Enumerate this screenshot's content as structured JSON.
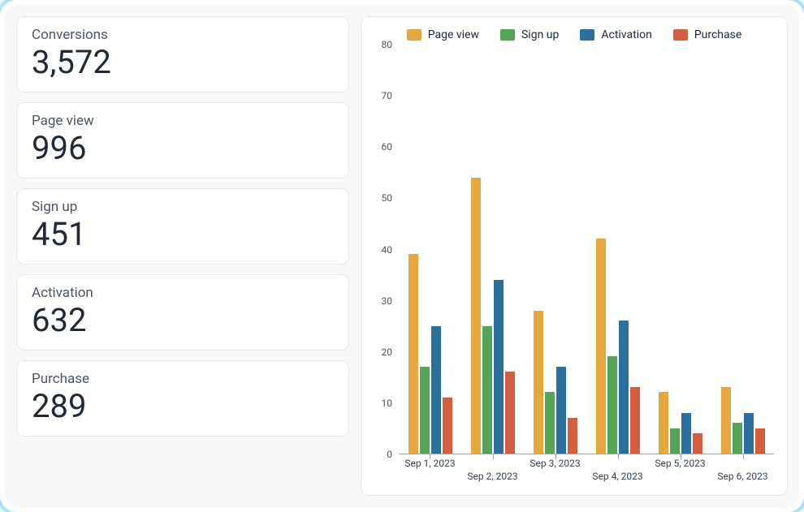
{
  "metrics": [
    {
      "label": "Conversions",
      "value": "3,572"
    },
    {
      "label": "Page view",
      "value": "996"
    },
    {
      "label": "Sign up",
      "value": "451"
    },
    {
      "label": "Activation",
      "value": "632"
    },
    {
      "label": "Purchase",
      "value": "289"
    }
  ],
  "legend": [
    {
      "name": "Page view",
      "color": "#e6a73c"
    },
    {
      "name": "Sign up",
      "color": "#55a457"
    },
    {
      "name": "Activation",
      "color": "#2b6f9c"
    },
    {
      "name": "Purchase",
      "color": "#d55d42"
    }
  ],
  "chart_data": {
    "type": "bar",
    "title": "",
    "xlabel": "",
    "ylabel": "",
    "ylim": [
      0,
      80
    ],
    "yticks": [
      0,
      10,
      20,
      30,
      40,
      50,
      60,
      70,
      80
    ],
    "categories": [
      "Sep 1, 2023",
      "Sep 2, 2023",
      "Sep 3, 2023",
      "Sep 4, 2023",
      "Sep 5, 2023",
      "Sep 6, 2023"
    ],
    "series": [
      {
        "name": "Page view",
        "color": "#e6a73c",
        "values": [
          39,
          54,
          28,
          42,
          12,
          13
        ]
      },
      {
        "name": "Sign up",
        "color": "#55a457",
        "values": [
          17,
          25,
          12,
          19,
          5,
          6
        ]
      },
      {
        "name": "Activation",
        "color": "#2b6f9c",
        "values": [
          25,
          34,
          17,
          26,
          8,
          8
        ]
      },
      {
        "name": "Purchase",
        "color": "#d55d42",
        "values": [
          11,
          16,
          7,
          13,
          4,
          5
        ]
      }
    ]
  }
}
